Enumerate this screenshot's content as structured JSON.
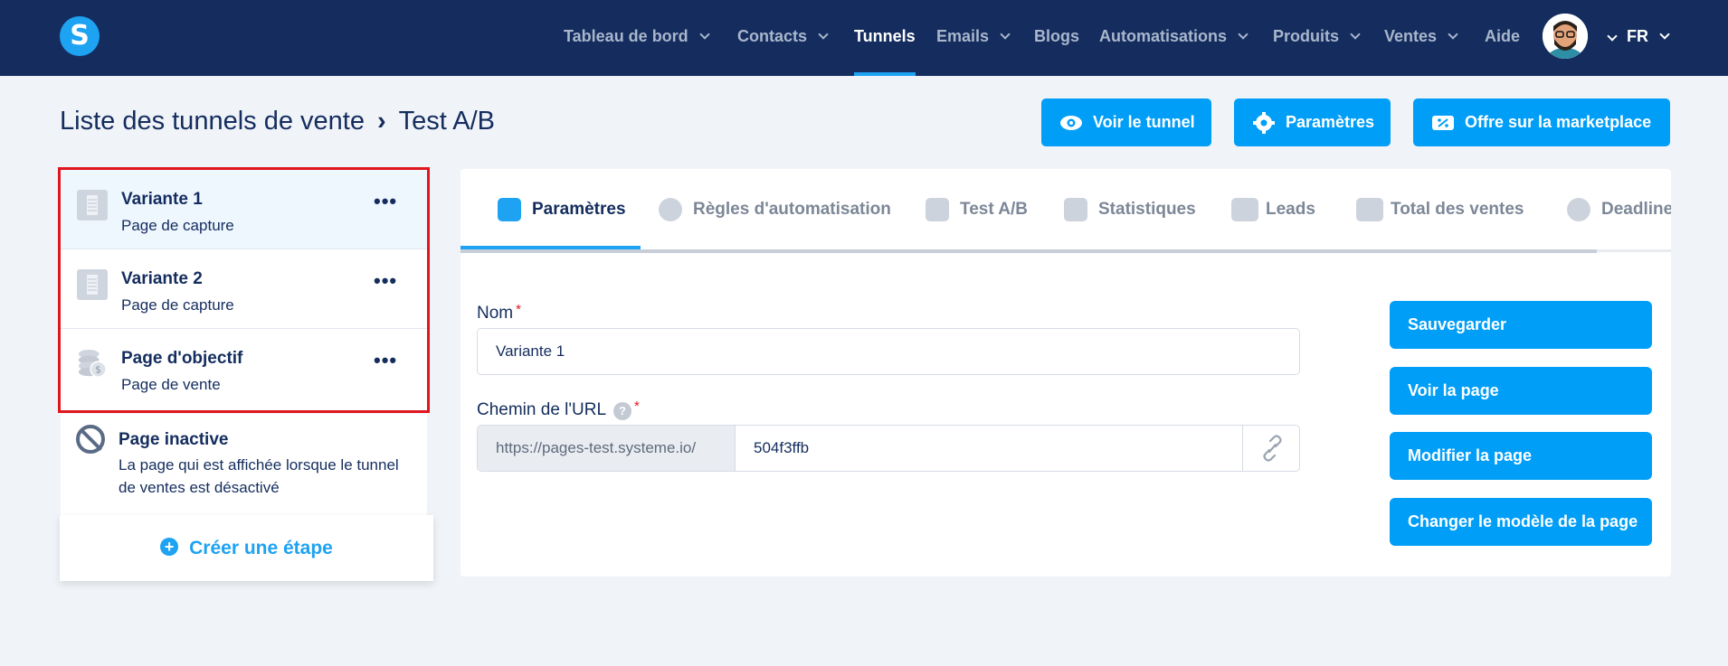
{
  "nav": {
    "logo": "S",
    "items": [
      {
        "label": "Tableau de bord",
        "dropdown": true
      },
      {
        "label": "Contacts",
        "dropdown": true
      },
      {
        "label": "Tunnels",
        "dropdown": false,
        "active": true
      },
      {
        "label": "Emails",
        "dropdown": true
      },
      {
        "label": "Blogs",
        "dropdown": false
      },
      {
        "label": "Automatisations",
        "dropdown": true
      },
      {
        "label": "Produits",
        "dropdown": true
      },
      {
        "label": "Ventes",
        "dropdown": true
      },
      {
        "label": "Aide",
        "dropdown": false
      }
    ],
    "language": "FR"
  },
  "header": {
    "breadcrumb_root": "Liste des tunnels de vente",
    "breadcrumb_current": "Test A/B",
    "buttons": {
      "view_funnel": "Voir le tunnel",
      "settings": "Paramètres",
      "marketplace": "Offre sur la marketplace"
    }
  },
  "steps": [
    {
      "title": "Variante 1",
      "subtitle": "Page de capture",
      "icon": "page-icon"
    },
    {
      "title": "Variante 2",
      "subtitle": "Page de capture",
      "icon": "page-icon"
    },
    {
      "title": "Page d'objectif",
      "subtitle": "Page de vente",
      "icon": "coins-icon"
    }
  ],
  "inactive": {
    "title": "Page inactive",
    "description": "La page qui est affichée lorsque le tunnel de ventes est désactivé"
  },
  "create_step": "Créer une étape",
  "tabs": [
    {
      "label": "Paramètres",
      "icon": "sliders-icon",
      "active": true
    },
    {
      "label": "Règles d'automatisation",
      "icon": "bolt-icon"
    },
    {
      "label": "Test A/B",
      "icon": "split-icon"
    },
    {
      "label": "Statistiques",
      "icon": "bar-chart-icon"
    },
    {
      "label": "Leads",
      "icon": "users-icon"
    },
    {
      "label": "Total des ventes",
      "icon": "dollar-icon"
    },
    {
      "label": "Deadline",
      "icon": "clock-icon"
    }
  ],
  "form": {
    "name_label": "Nom",
    "name_value": "Variante 1",
    "url_label": "Chemin de l'URL",
    "url_prefix": "https://pages-test.systeme.io/",
    "url_slug": "504f3ffb"
  },
  "actions": {
    "save": "Sauvegarder",
    "view_page": "Voir la page",
    "edit_page": "Modifier la page",
    "change_template": "Changer le modèle de la page"
  },
  "colors": {
    "nav_bg": "#142d5e",
    "accent": "#009ef7",
    "highlight_border": "#e0161e"
  }
}
